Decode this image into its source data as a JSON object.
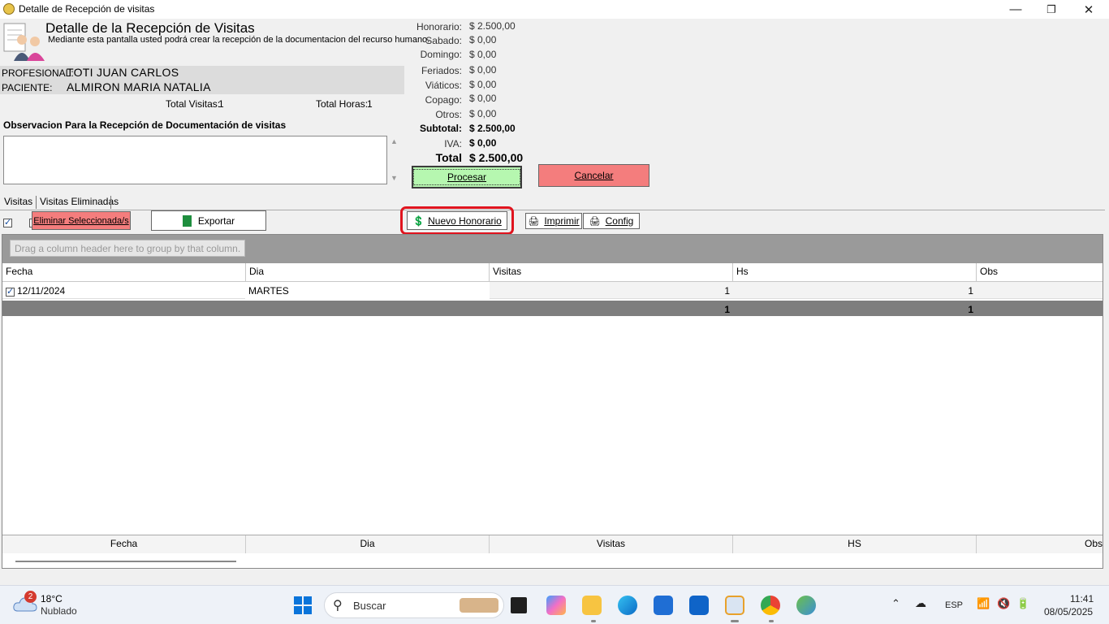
{
  "window": {
    "title": "Detalle de Recepción de visitas",
    "minimize": "—",
    "maximize": "❐",
    "close": "✕"
  },
  "header": {
    "title": "Detalle de la Recepción de Visitas",
    "description": "Mediante esta pantalla usted podrá crear la recepción de la documentacion del recurso humano.",
    "profesional_label": "PROFESIONAL:",
    "profesional_value": "TOTI JUAN CARLOS",
    "paciente_label": "PACIENTE:",
    "paciente_value": "ALMIRON MARIA NATALIA",
    "total_visitas_label": "Total Visitas:",
    "total_visitas_value": "1",
    "total_horas_label": "Total Horas:",
    "total_horas_value": "1"
  },
  "observacion": {
    "label": "Observacion Para la Recepción de Documentación de visitas",
    "value": ""
  },
  "totals": {
    "honorario_label": "Honorario:",
    "honorario": "$ 2.500,00",
    "sabado_label": "Sabado:",
    "sabado": "$ 0,00",
    "domingo_label": "Domingo:",
    "domingo": "$ 0,00",
    "feriados_label": "Feriados:",
    "feriados": "$ 0,00",
    "viaticos_label": "Viáticos:",
    "viaticos": "$ 0,00",
    "copago_label": "Copago:",
    "copago": "$ 0,00",
    "otros_label": "Otros:",
    "otros": "$ 0,00",
    "subtotal_label": "Subtotal:",
    "subtotal": "$ 2.500,00",
    "iva_label": "IVA:",
    "iva": "$ 0,00",
    "total_label": "Total",
    "total": "$ 2.500,00"
  },
  "actions": {
    "procesar": "Procesar",
    "cancelar": "Cancelar",
    "eliminar": "Eliminar Seleccionada/s",
    "exportar": "Exportar",
    "nuevo_honorario": "Nuevo Honorario",
    "imprimir": "Imprimir",
    "config": "Config"
  },
  "tabs": [
    "Visitas",
    "Visitas Eliminadas"
  ],
  "grid": {
    "group_hint": "Drag a column header here to group by that column.",
    "columns": [
      "Fecha",
      "Dia",
      "Visitas",
      "Hs",
      "Obs"
    ],
    "rows": [
      {
        "fecha": "12/11/2024",
        "dia": "MARTES",
        "visitas": "1",
        "hs": "1",
        "obs": ""
      }
    ],
    "summary": {
      "visitas": "1",
      "hs": "1"
    },
    "footer": [
      "Fecha",
      "Dia",
      "Visitas",
      "HS",
      "Obs"
    ]
  },
  "taskbar": {
    "weather_temp": "18°C",
    "weather_desc": "Nublado",
    "weather_badge": "2",
    "search_placeholder": "Buscar",
    "lang": "ESP",
    "time": "11:41",
    "date": "08/05/2025"
  },
  "colors": {
    "procesar_bg": "#b6f7b0",
    "cancelar_bg": "#f47d7d",
    "eliminar_bg": "#f47d7d",
    "highlight_ring": "#e0141e"
  }
}
